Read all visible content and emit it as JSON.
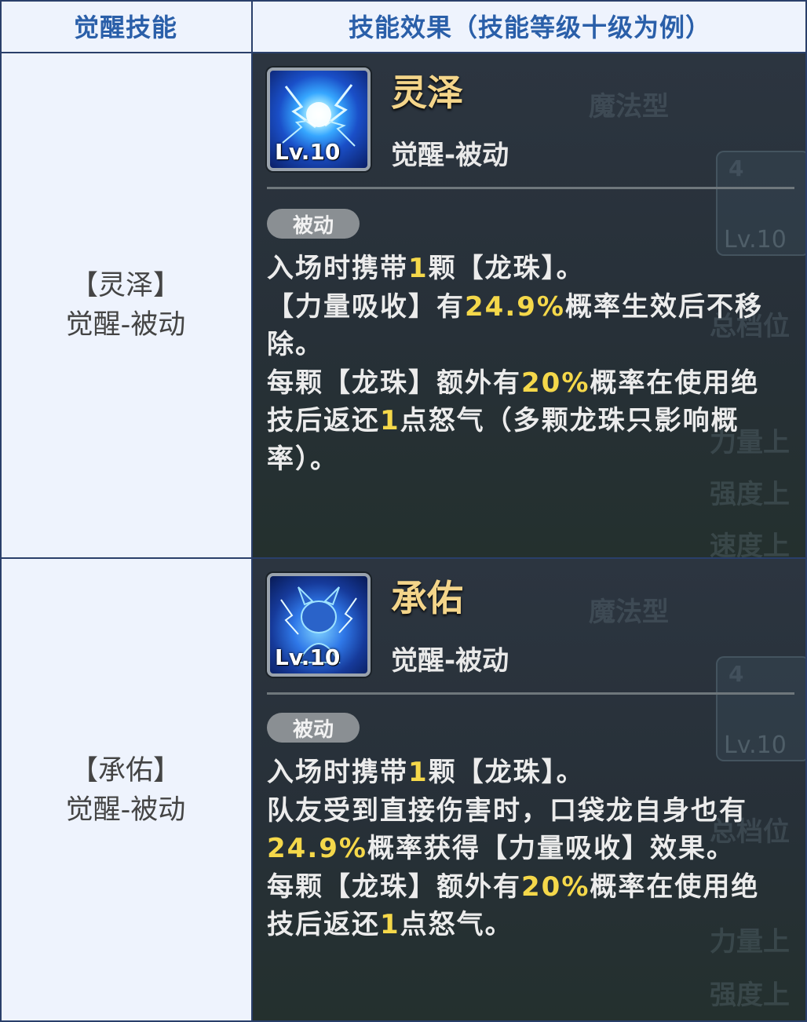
{
  "header": {
    "col_skill": "觉醒技能",
    "col_effect": "技能效果（技能等级十级为例）"
  },
  "rows": [
    {
      "left_name": "【灵泽】",
      "left_type": "觉醒-被动",
      "card": {
        "name": "灵泽",
        "level": "Lv.10",
        "type": "觉醒-被动",
        "badge": "被动",
        "icon": "lightning-orb-icon",
        "desc": {
          "l1a": "入场时携带",
          "l1b": "1",
          "l1c": "颗【龙珠】。",
          "l2a": "【力量吸收】有",
          "l2b": "24.9%",
          "l2c": "概率生效后不移",
          "l3": "除。",
          "l4a": "每颗【龙珠】额外有",
          "l4b": "20%",
          "l4c": "概率在使用绝",
          "l5a": "技后返还",
          "l5b": "1",
          "l5c": "点怒气（多颗龙珠只影响概",
          "l6": "率）。"
        }
      }
    },
    {
      "left_name": "【承佑】",
      "left_type": "觉醒-被动",
      "card": {
        "name": "承佑",
        "level": "Lv.10",
        "type": "觉醒-被动",
        "badge": "被动",
        "icon": "dragon-silhouette-icon",
        "desc": {
          "l1a": "入场时携带",
          "l1b": "1",
          "l1c": "颗【龙珠】。",
          "l2": "队友受到直接伤害时，口袋龙自身也有",
          "l3a": "24.9%",
          "l3b": "概率获得【力量吸收】效果。",
          "l4a": "每颗【龙珠】额外有",
          "l4b": "20%",
          "l4c": "概率在使用绝",
          "l5a": "技后返还",
          "l5b": "1",
          "l5c": "点怒气。"
        }
      }
    }
  ],
  "background_text": {
    "magic_type": "魔法型",
    "badge_num": "4",
    "lv": "Lv.10",
    "g1": "总档位",
    "g2": "力量上",
    "g3": "强度上",
    "g4": "速度上"
  },
  "colors": {
    "header_text": "#2a5fa9",
    "cell_bg": "#eef3fd",
    "highlight": "#f5d84a",
    "skill_name": "#f4d58a"
  }
}
